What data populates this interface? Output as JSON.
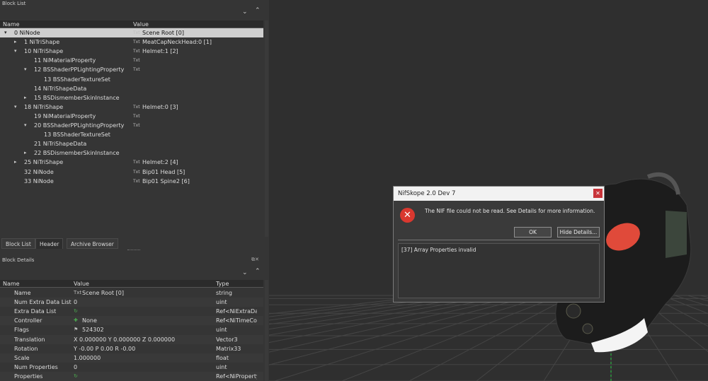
{
  "block_list": {
    "title": "Block List",
    "col_name": "Name",
    "col_value": "Value",
    "rows": [
      {
        "name": "0 NiNode",
        "icon": "Txt",
        "value": "Scene Root [0]"
      },
      {
        "name": "1 NiTriShape",
        "icon": "Txt",
        "value": "MeatCapNeckHead:0 [1]"
      },
      {
        "name": "10 NiTriShape",
        "icon": "Txt",
        "value": "Helmet:1 [2]"
      },
      {
        "name": "11 NiMaterialProperty",
        "icon": "Txt",
        "value": ""
      },
      {
        "name": "12 BSShaderPPLightingProperty",
        "icon": "Txt",
        "value": ""
      },
      {
        "name": "13 BSShaderTextureSet",
        "icon": "",
        "value": ""
      },
      {
        "name": "14 NiTriShapeData",
        "icon": "",
        "value": ""
      },
      {
        "name": "15 BSDismemberSkinInstance",
        "icon": "",
        "value": ""
      },
      {
        "name": "18 NiTriShape",
        "icon": "Txt",
        "value": "Helmet:0 [3]"
      },
      {
        "name": "19 NiMaterialProperty",
        "icon": "Txt",
        "value": ""
      },
      {
        "name": "20 BSShaderPPLightingProperty",
        "icon": "Txt",
        "value": ""
      },
      {
        "name": "13 BSShaderTextureSet",
        "icon": "",
        "value": ""
      },
      {
        "name": "21 NiTriShapeData",
        "icon": "",
        "value": ""
      },
      {
        "name": "22 BSDismemberSkinInstance",
        "icon": "",
        "value": ""
      },
      {
        "name": "25 NiTriShape",
        "icon": "Txt",
        "value": "Helmet:2 [4]"
      },
      {
        "name": "32 NiNode",
        "icon": "Txt",
        "value": "Bip01 Head [5]"
      },
      {
        "name": "33 NiNode",
        "icon": "Txt",
        "value": "Bip01 Spine2 [6]"
      }
    ]
  },
  "tabs": [
    "Block List",
    "Header",
    "Archive Browser"
  ],
  "block_details": {
    "title": "Block Details",
    "col_name": "Name",
    "col_value": "Value",
    "col_type": "Type",
    "rows": [
      {
        "name": "Name",
        "value": "Scene Root [0]",
        "type": "string"
      },
      {
        "name": "Num Extra Data List",
        "value": "0",
        "type": "uint"
      },
      {
        "name": "Extra Data List",
        "value": "",
        "type": "Ref<NiExtraData>"
      },
      {
        "name": "Controller",
        "value": "None",
        "type": "Ref<NiTimeController>"
      },
      {
        "name": "Flags",
        "value": "524302",
        "type": "uint"
      },
      {
        "name": "Translation",
        "value": "X 0.000000 Y 0.000000 Z 0.000000",
        "type": "Vector3"
      },
      {
        "name": "Rotation",
        "value": "Y -0.00 P 0.00 R -0.00",
        "type": "Matrix33"
      },
      {
        "name": "Scale",
        "value": "1.000000",
        "type": "float"
      },
      {
        "name": "Num Properties",
        "value": "0",
        "type": "uint"
      },
      {
        "name": "Properties",
        "value": "",
        "type": "Ref<NiProperty>"
      }
    ]
  },
  "dialog": {
    "title": "NifSkope 2.0 Dev 7",
    "message": "The NIF file could not be read. See Details for more information.",
    "ok_label": "OK",
    "details_label": "Hide Details...",
    "details_text": "[37] Array Properties invalid"
  },
  "colors": {
    "error_red": "#d9382f",
    "selection": "#cfcfcf",
    "viewport_bg": "#2f2f2f"
  }
}
